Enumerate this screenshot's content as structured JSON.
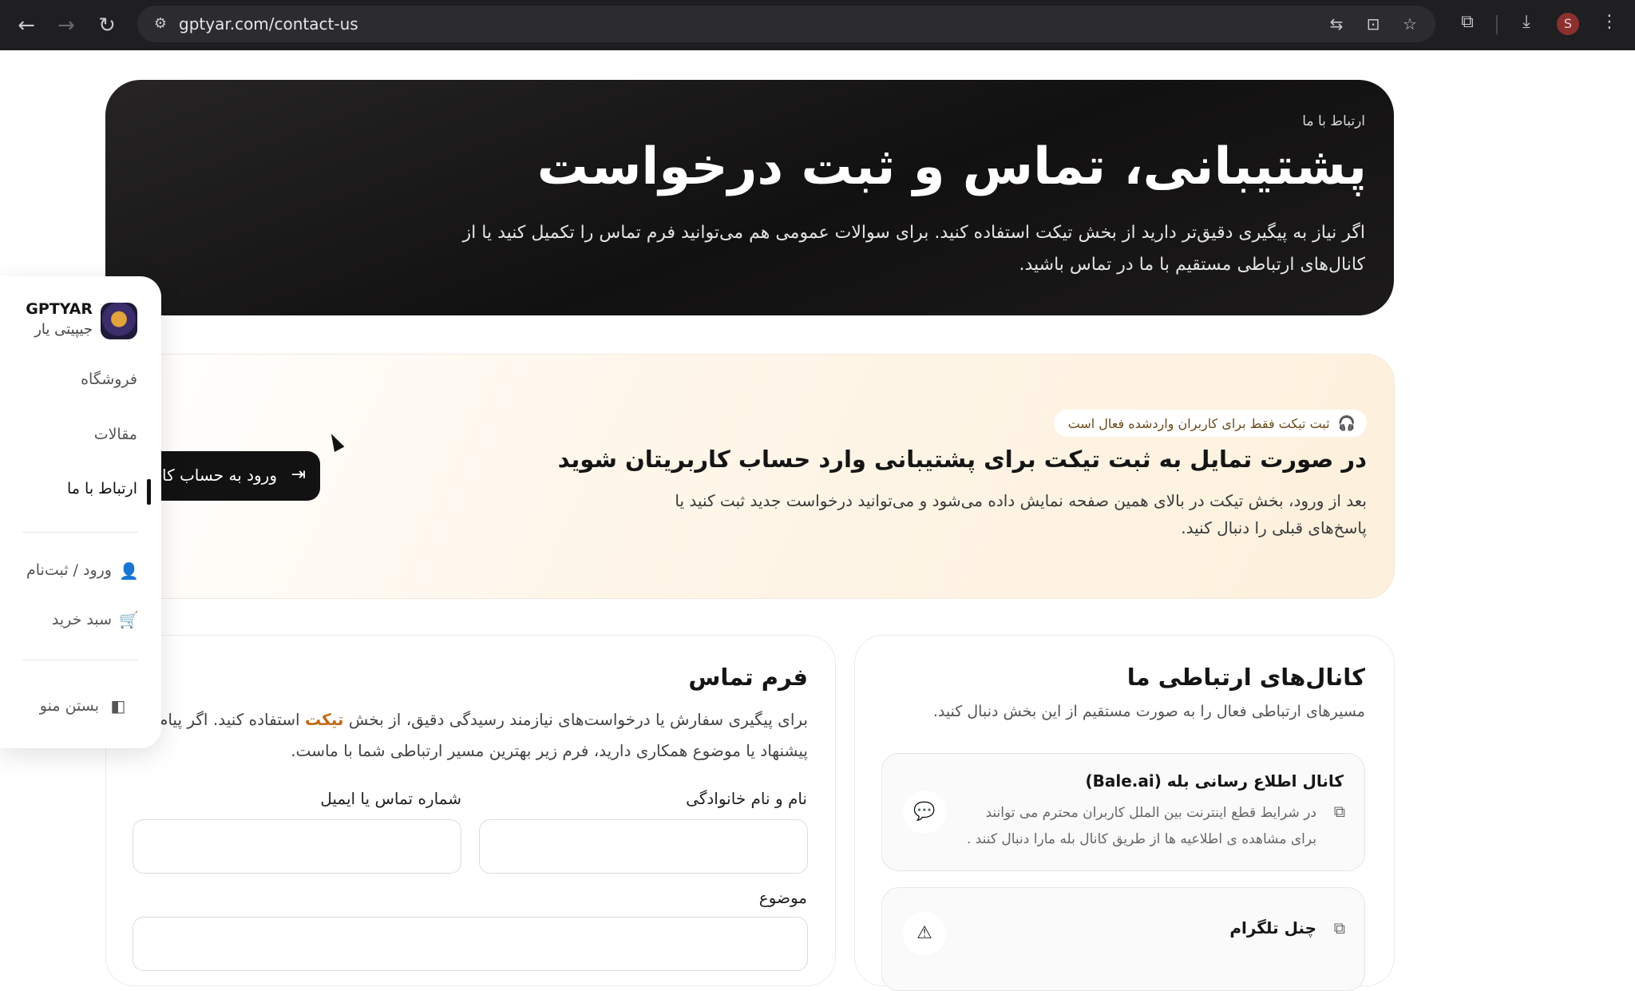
{
  "browser": {
    "url": "gptyar.com/contact-us",
    "profile_initial": "S"
  },
  "hero": {
    "eyebrow": "ارتباط با ما",
    "title": "پشتیبانی، تماس و ثبت درخواست",
    "description": "اگر نیاز به پیگیری دقیق‌تر دارید از بخش تیکت استفاده کنید. برای سوالات عمومی هم می‌توانید فرم تماس را تکمیل کنید یا از کانال‌های ارتباطی مستقیم با ما در تماس باشید."
  },
  "sidebar": {
    "brand_name": "GPTYAR",
    "brand_sub": "جیپیتی یار",
    "items": [
      {
        "label": "فروشگاه"
      },
      {
        "label": "مقالات"
      },
      {
        "label": "ارتباط با ما",
        "active": true
      }
    ],
    "login_label": "ورود / ثبت‌نام",
    "cart_label": "سبد خرید",
    "close_menu_label": "بستن منو"
  },
  "ticket": {
    "pill": "ثبت تیکت فقط برای کاربران واردشده فعال است",
    "title": "در صورت تمایل به ثبت تیکت برای پشتیبانی وارد حساب کاربریتان شوید",
    "description": "بعد از ورود، بخش تیکت در بالای همین صفحه نمایش داده می‌شود و می‌توانید درخواست جدید ثبت کنید یا پاسخ‌های قبلی را دنبال کنید.",
    "login_button": "ورود به حساب کاربری"
  },
  "form": {
    "title": "فرم تماس",
    "desc_line1_before": "برای پیگیری سفارش یا درخواست‌های نیازمند رسیدگی دقیق، از بخش ",
    "desc_accent": "تیکت",
    "desc_line1_after": " استفاده کنید. اگر پیام عمومی",
    "desc_line2": "پیشنهاد یا موضوع همکاری دارید، فرم زیر بهترین مسیر ارتباطی شما با ماست.",
    "name_label": "نام و نام خانوادگی",
    "contact_label": "شماره تماس یا ایمیل",
    "subject_label": "موضوع",
    "accent_color": "#c06a12"
  },
  "channels": {
    "title": "کانال‌های ارتباطی ما",
    "description": "مسیرهای ارتباطی فعال را به صورت مستقیم از این بخش دنبال کنید.",
    "items": [
      {
        "title": "کانال اطلاع رسانی بله (Bale.ai)",
        "description": "در شرایط قطع اینترنت بین الملل کاربران محترم می توانند برای مشاهده ی اطلاعیه ها از طریق کانال بله مارا دنبال کنند .",
        "icon": "chat-bubble-icon"
      },
      {
        "title": "چنل تلگرام",
        "description": "",
        "icon": "warning-triangle-icon"
      }
    ]
  }
}
